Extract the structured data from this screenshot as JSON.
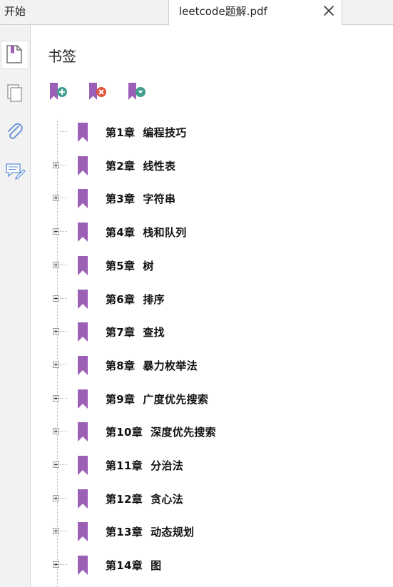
{
  "tabs": {
    "home_label": "开始",
    "doc_label": "leetcode题解.pdf"
  },
  "panel": {
    "title": "书签"
  },
  "toolbar": {
    "icons": [
      "add-bookmark-icon",
      "delete-bookmark-icon",
      "bookmark-options-icon"
    ]
  },
  "colors": {
    "bookmark": "#9b5fb5",
    "add": "#3f9e8c",
    "delete": "#e2533a"
  },
  "bookmarks": [
    {
      "label": "第1章  编程技巧",
      "expandable": false
    },
    {
      "label": "第2章  线性表",
      "expandable": true
    },
    {
      "label": "第3章  字符串",
      "expandable": true
    },
    {
      "label": "第4章  栈和队列",
      "expandable": true
    },
    {
      "label": "第5章  树",
      "expandable": true
    },
    {
      "label": "第6章  排序",
      "expandable": true
    },
    {
      "label": "第7章  查找",
      "expandable": true
    },
    {
      "label": "第8章  暴力枚举法",
      "expandable": true
    },
    {
      "label": "第9章  广度优先搜索",
      "expandable": true
    },
    {
      "label": "第10章  深度优先搜索",
      "expandable": true
    },
    {
      "label": "第11章  分治法",
      "expandable": true
    },
    {
      "label": "第12章  贪心法",
      "expandable": true
    },
    {
      "label": "第13章  动态规划",
      "expandable": true
    },
    {
      "label": "第14章  图",
      "expandable": true
    }
  ]
}
